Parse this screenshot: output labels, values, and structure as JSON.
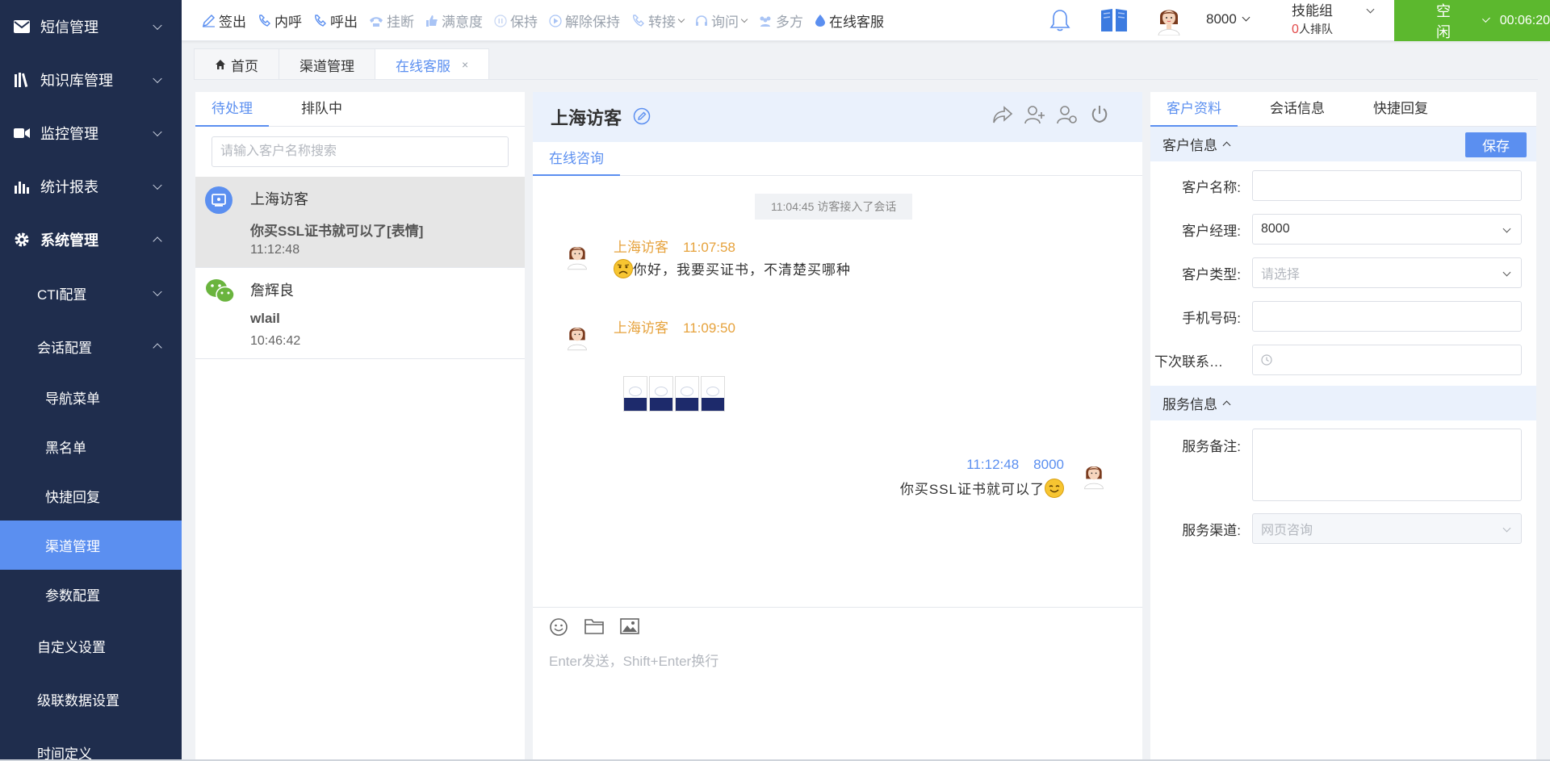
{
  "sidebar": {
    "items": [
      {
        "label": "短信管理",
        "icon": "mail-icon"
      },
      {
        "label": "知识库管理",
        "icon": "book-shelf-icon"
      },
      {
        "label": "监控管理",
        "icon": "video-camera-icon"
      },
      {
        "label": "统计报表",
        "icon": "bar-chart-icon"
      },
      {
        "label": "系统管理",
        "icon": "gear-icon"
      }
    ],
    "sub_items": [
      {
        "label": "CTI配置"
      },
      {
        "label": "会话配置"
      }
    ],
    "session_items": [
      {
        "label": "导航菜单"
      },
      {
        "label": "黑名单"
      },
      {
        "label": "快捷回复"
      },
      {
        "label": "渠道管理"
      },
      {
        "label": "参数配置"
      }
    ],
    "more_items": [
      {
        "label": "自定义设置"
      },
      {
        "label": "级联数据设置"
      },
      {
        "label": "时间定义"
      }
    ],
    "colors": {
      "background": "#1f2d4d",
      "active": "#5b8ff0"
    }
  },
  "toolbar": {
    "actions": [
      {
        "label": "签出",
        "icon": "pen-icon"
      },
      {
        "label": "内呼",
        "icon": "phone-icon"
      },
      {
        "label": "呼出",
        "icon": "phone-icon"
      },
      {
        "label": "挂断",
        "icon": "hangup-icon"
      },
      {
        "label": "满意度",
        "icon": "thumbs-up-icon"
      },
      {
        "label": "保持",
        "icon": "pause-icon"
      },
      {
        "label": "解除保持",
        "icon": "play-icon"
      },
      {
        "label": "转接",
        "icon": "transfer-icon"
      },
      {
        "label": "询问",
        "icon": "headset-icon"
      },
      {
        "label": "多方",
        "icon": "group-icon"
      },
      {
        "label": "在线客服",
        "icon": "drop-icon"
      }
    ],
    "extension": "8000",
    "skill_group": {
      "title": "技能组",
      "queue_count": "0",
      "queue_suffix": "人排队"
    },
    "status": {
      "label": "空闲",
      "timer": "00:06:20",
      "color": "#5cb82e"
    }
  },
  "tabs": [
    {
      "label": "首页"
    },
    {
      "label": "渠道管理"
    },
    {
      "label": "在线客服",
      "close": "×"
    }
  ],
  "sessions_panel": {
    "tabs": [
      {
        "label": "待处理"
      },
      {
        "label": "排队中"
      }
    ],
    "search_placeholder": "请输入客户名称搜索",
    "sessions": [
      {
        "name": "上海访客",
        "last_msg": "你买SSL证书就可以了[表情]",
        "time": "11:12:48",
        "channel_icon": "web-chat-icon"
      },
      {
        "name": "詹辉良",
        "last_msg": "wlail",
        "time": "10:46:42",
        "channel_icon": "wechat-icon"
      }
    ]
  },
  "chat": {
    "title": "上海访客",
    "subtab": "在线咨询",
    "system_note": "11:04:45 访客接入了会话",
    "messages": [
      {
        "sender": "上海访客",
        "time": "11:07:58",
        "text": "你好，我要买证书，不清楚买哪种"
      },
      {
        "sender": "上海访客",
        "time": "11:09:50",
        "text": ""
      },
      {
        "sender": "8000",
        "time": "11:12:48",
        "text": "你买SSL证书就可以了"
      }
    ],
    "compose_placeholder": "Enter发送，Shift+Enter换行"
  },
  "customer_panel": {
    "tabs": [
      {
        "label": "客户资料"
      },
      {
        "label": "会话信息"
      },
      {
        "label": "快捷回复"
      }
    ],
    "customer_section": "客户信息",
    "save_label": "保存",
    "fields": {
      "name_label": "客户名称:",
      "name_value": "",
      "manager_label": "客户经理:",
      "manager_value": "8000",
      "type_label": "客户类型:",
      "type_placeholder": "请选择",
      "phone_label": "手机号码:",
      "phone_value": "",
      "next_contact_label": "下次联系…",
      "next_contact_value": ""
    },
    "service_section": "服务信息",
    "service_fields": {
      "remark_label": "服务备注:",
      "remark_value": "",
      "channel_label": "服务渠道:",
      "channel_value": "网页咨询"
    }
  }
}
